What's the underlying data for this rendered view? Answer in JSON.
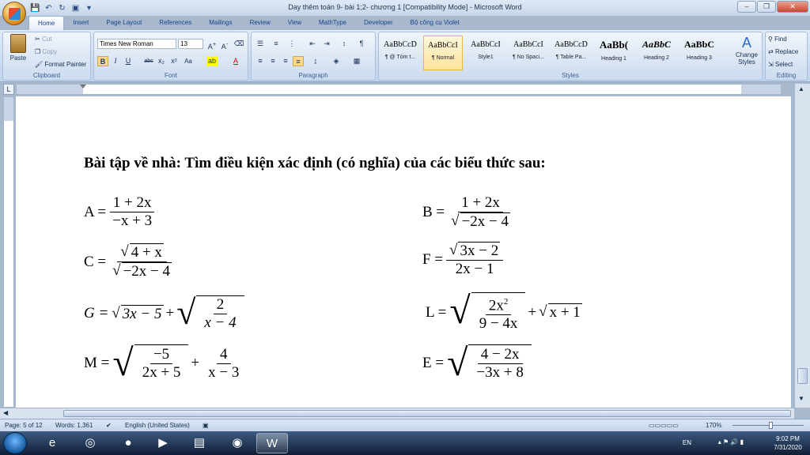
{
  "window": {
    "title": "Day thêm toán 9- bài 1;2- chương 1 [Compatibility Mode] - Microsoft Word",
    "controls": {
      "min": "–",
      "max": "❐",
      "close": "✕"
    }
  },
  "tabs": [
    {
      "label": "Home"
    },
    {
      "label": "Insert"
    },
    {
      "label": "Page Layout"
    },
    {
      "label": "References"
    },
    {
      "label": "Mailings"
    },
    {
      "label": "Review"
    },
    {
      "label": "View"
    },
    {
      "label": "MathType"
    },
    {
      "label": "Developer"
    },
    {
      "label": "Bộ công cụ Violet"
    }
  ],
  "ribbon": {
    "clipboard": {
      "paste": "Paste",
      "cut": "Cut",
      "copy": "Copy",
      "format_painter": "Format Painter",
      "label": "Clipboard"
    },
    "font": {
      "family": "Times New Roman",
      "size": "13",
      "label": "Font"
    },
    "paragraph": {
      "label": "Paragraph"
    },
    "styles": {
      "label": "Styles",
      "items": [
        {
          "sample": "AaBbCcD",
          "name": "¶ @ Tóm t..."
        },
        {
          "sample": "AaBbCcI",
          "name": "¶ Normal"
        },
        {
          "sample": "AaBbCcI",
          "name": "Style1"
        },
        {
          "sample": "AaBbCcI",
          "name": "¶ No Spaci..."
        },
        {
          "sample": "AaBbCcD",
          "name": "¶ Table Pa..."
        },
        {
          "sample": "AaBb(",
          "name": "Heading 1"
        },
        {
          "sample": "AaBbC",
          "name": "Heading 2"
        },
        {
          "sample": "AaBbC",
          "name": "Heading 3"
        }
      ],
      "change_styles": "Change Styles"
    },
    "editing": {
      "find": "Find",
      "replace": "Replace",
      "select": "Select",
      "label": "Editing"
    }
  },
  "document": {
    "heading": "Bài tập về nhà: Tìm điều kiện xác định (có nghĩa) của các biểu thức sau:",
    "A": {
      "lhs": "A =",
      "num": "1 + 2x",
      "den": "−x + 3"
    },
    "B": {
      "lhs": "B =",
      "num": "1 + 2x",
      "den": "−2x − 4"
    },
    "C": {
      "lhs": "C =",
      "num": "4 + x",
      "den": "−2x − 4"
    },
    "F": {
      "lhs": "F =",
      "num": "3x − 2",
      "den": "2x − 1"
    },
    "G": {
      "lhs": "G =",
      "rad1": "3x − 5",
      "plus": "+",
      "num": "2",
      "den": "x − 4"
    },
    "L": {
      "lhs": "L =",
      "num": "2x",
      "exp": "2",
      "den": "9 − 4x",
      "plus": "+",
      "rad2": "x + 1"
    },
    "M": {
      "lhs": "M =",
      "num1": "−5",
      "den1": "2x + 5",
      "plus": "+",
      "num2": "4",
      "den2": "x − 3"
    },
    "E": {
      "lhs": "E =",
      "num": "4 − 2x",
      "den": "−3x + 8"
    }
  },
  "status": {
    "page": "Page: 5 of 12",
    "words": "Words: 1,361",
    "language": "English (United States)",
    "zoom": "170%"
  },
  "taskbar": {
    "lang": "EN",
    "time": "9:02 PM",
    "date": "7/31/2020"
  }
}
